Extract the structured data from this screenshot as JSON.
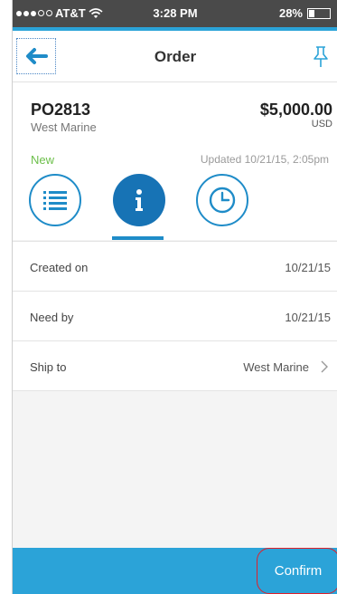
{
  "status_bar": {
    "carrier": "AT&T",
    "time": "3:28 PM",
    "battery_percent": "28%",
    "battery_level": 0.28,
    "signal_bars_filled": 3,
    "signal_bars_total": 5
  },
  "nav": {
    "title": "Order",
    "back_icon": "arrow-left-icon",
    "pin_icon": "pin-icon"
  },
  "order": {
    "po_number": "PO2813",
    "vendor": "West Marine",
    "amount": "$5,000.00",
    "currency": "USD",
    "status": "New",
    "updated": "Updated 10/21/15, 2:05pm"
  },
  "tabs": [
    {
      "icon": "list-icon",
      "active": false
    },
    {
      "icon": "info-icon",
      "active": true
    },
    {
      "icon": "clock-icon",
      "active": false
    }
  ],
  "details": [
    {
      "label": "Created on",
      "value": "10/21/15"
    },
    {
      "label": "Need by",
      "value": "10/21/15"
    },
    {
      "label": "Ship to",
      "value": "West Marine"
    }
  ],
  "actions": {
    "confirm_label": "Confirm"
  },
  "colors": {
    "accent": "#2ba3d8",
    "tab_active": "#1773b5",
    "status_new": "#6cbf4a",
    "status_bar_bg": "#4a4a4a"
  }
}
